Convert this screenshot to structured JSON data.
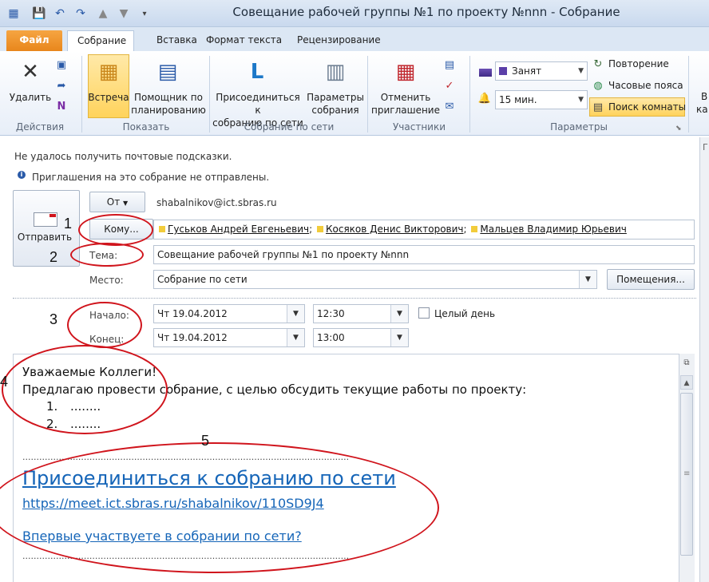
{
  "window": {
    "title": "Совещание рабочей группы №1 по проекту №nnn - Собрание"
  },
  "tabs": [
    "Файл",
    "Собрание",
    "Вставка",
    "Формат текста",
    "Рецензирование"
  ],
  "ribbon": {
    "actions": {
      "label": "Действия",
      "delete": "Удалить"
    },
    "show": {
      "label": "Показать",
      "meeting": "Встреча",
      "assistant_1": "Помощник по",
      "assistant_2": "планированию"
    },
    "online": {
      "label": "Собрание по сети",
      "join_1": "Присоединиться к",
      "join_2": "собранию по сети",
      "params_1": "Параметры",
      "params_2": "собрания"
    },
    "attendees": {
      "label": "Участники",
      "cancel_1": "Отменить",
      "cancel_2": "приглашение"
    },
    "options": {
      "label": "Параметры",
      "status": "Занят",
      "reminder": "15 мин.",
      "recurrence": "Повторение",
      "timezones": "Часовые пояса",
      "room_finder": "Поиск комнаты"
    },
    "overflow_1": "В",
    "overflow_2": "ка"
  },
  "info": {
    "mailtips": "Не удалось получить почтовые подсказки.",
    "not_sent": "Приглашения на это собрание не отправлены."
  },
  "form": {
    "send": "Отправить",
    "from_btn": "От",
    "from_value": "shabalnikov@ict.sbras.ru",
    "to_btn": "Кому...",
    "recipients": [
      "Гуськов Андрей Евгеньевич",
      "Косяков Денис Викторович",
      "Мальцев Владимир Юрьевич"
    ],
    "subject_label": "Тема:",
    "subject_value": "Совещание рабочей группы №1 по проекту №nnn",
    "location_label": "Место:",
    "location_value": "Собрание по сети",
    "rooms_btn": "Помещения...",
    "start_label": "Начало:",
    "start_date": "Чт 19.04.2012",
    "start_time": "12:30",
    "allday": "Целый день",
    "end_label": "Конец:",
    "end_date": "Чт 19.04.2012",
    "end_time": "13:00"
  },
  "body": {
    "greeting": "Уважаемые Коллеги!",
    "line1": "Предлагаю провести собрание, с целью обсудить текущие работы по проекту:",
    "items": [
      "1.",
      "2."
    ],
    "item_text": "........",
    "dots": "......................................................................................................................................",
    "join_link": "Присоединиться к собранию по сети",
    "join_url": "https://meet.ict.sbras.ru/shabalnikov/110SD9J4",
    "first_time": "Впервые участвуете в собрании по сети?"
  },
  "annotations": [
    "1",
    "2",
    "3",
    "4",
    "5"
  ],
  "colors": {
    "accent": "#e8861c",
    "annotation": "#d0141c",
    "link": "#1565b8"
  }
}
